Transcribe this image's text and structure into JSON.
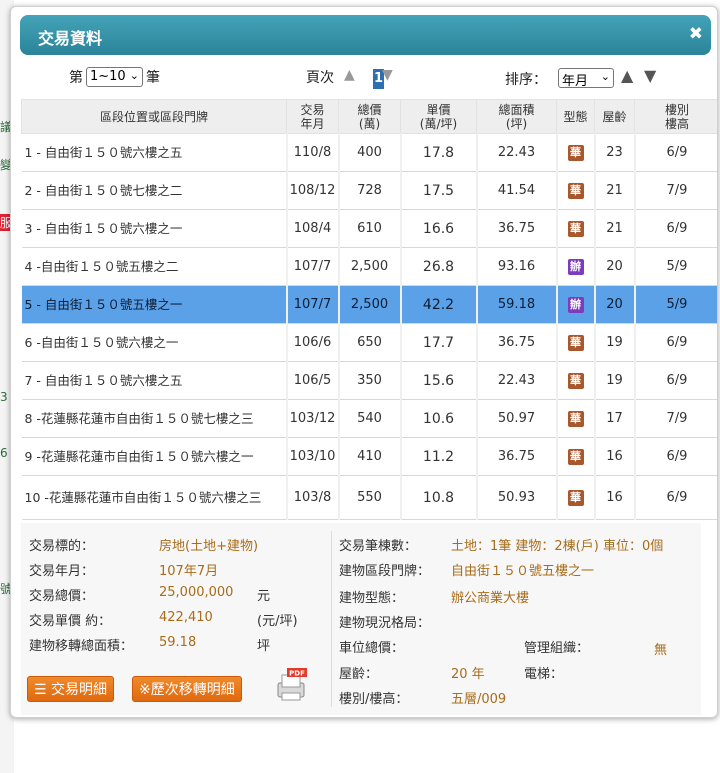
{
  "dialog": {
    "title": "交易資料",
    "close": "✖"
  },
  "controls": {
    "page_prefix": "第",
    "page_select": "1~10",
    "page_suffix": "筆",
    "page_label": "頁次",
    "page_current": "1",
    "sort_label": "排序：",
    "sort_select": "年月"
  },
  "table": {
    "headers": [
      "區段位置或區段門牌",
      "交易\n年月",
      "總價\n(萬)",
      "單價\n(萬/坪)",
      "總面積\n(坪)",
      "型態",
      "屋齡",
      "樓別\n樓高"
    ],
    "rows": [
      {
        "addr": "1 - 自由街１５０號六樓之五",
        "ym": "110/8",
        "total": "400",
        "unit": "17.8",
        "area": "22.43",
        "type": "華",
        "typeColor": "#a8582c",
        "age": "23",
        "floor": "6/9"
      },
      {
        "addr": "2 - 自由街１５０號七樓之二",
        "ym": "108/12",
        "total": "728",
        "unit": "17.5",
        "area": "41.54",
        "type": "華",
        "typeColor": "#a8582c",
        "age": "21",
        "floor": "7/9"
      },
      {
        "addr": "3 - 自由街１５０號六樓之一",
        "ym": "108/4",
        "total": "610",
        "unit": "16.6",
        "area": "36.75",
        "type": "華",
        "typeColor": "#a8582c",
        "age": "21",
        "floor": "6/9"
      },
      {
        "addr": "4 -自由街１５０號五樓之二",
        "ym": "107/7",
        "total": "2,500",
        "unit": "26.8",
        "area": "93.16",
        "type": "辦",
        "typeColor": "#7d3bbd",
        "age": "20",
        "floor": "5/9"
      },
      {
        "addr": "5 - 自由街１５０號五樓之一",
        "ym": "107/7",
        "total": "2,500",
        "unit": "42.2",
        "area": "59.18",
        "type": "辦",
        "typeColor": "#7d3bbd",
        "age": "20",
        "floor": "5/9",
        "selected": true
      },
      {
        "addr": "6 -自由街１５０號六樓之一",
        "ym": "106/6",
        "total": "650",
        "unit": "17.7",
        "area": "36.75",
        "type": "華",
        "typeColor": "#a8582c",
        "age": "19",
        "floor": "6/9"
      },
      {
        "addr": "7 - 自由街１５０號六樓之五",
        "ym": "106/5",
        "total": "350",
        "unit": "15.6",
        "area": "22.43",
        "type": "華",
        "typeColor": "#a8582c",
        "age": "19",
        "floor": "6/9"
      },
      {
        "addr": "8 -花蓮縣花蓮市自由街１５０號七樓之三",
        "ym": "103/12",
        "total": "540",
        "unit": "10.6",
        "area": "50.97",
        "type": "華",
        "typeColor": "#a8582c",
        "age": "17",
        "floor": "7/9"
      },
      {
        "addr": "9 -花蓮縣花蓮市自由街１５０號六樓之一",
        "ym": "103/10",
        "total": "410",
        "unit": "11.2",
        "area": "36.75",
        "type": "華",
        "typeColor": "#a8582c",
        "age": "16",
        "floor": "6/9"
      },
      {
        "addr": "10 -花蓮縣花蓮市自由街１５０號六樓之三",
        "ym": "103/8",
        "total": "550",
        "unit": "10.8",
        "area": "50.93",
        "type": "華",
        "typeColor": "#a8582c",
        "age": "16",
        "floor": "6/9",
        "tall": true
      }
    ]
  },
  "details": {
    "left": {
      "target_label": "交易標的：",
      "target_value": "房地(土地+建物)",
      "ym_label": "交易年月：",
      "ym_value": "107年7月",
      "total_label": "交易總價：",
      "total_value": "25,000,000",
      "total_unit": "元",
      "unit_label": "交易單價 約：",
      "unit_value": "422,410",
      "unit_unit": "(元/坪)",
      "area_label": "建物移轉總面積：",
      "area_value": "59.18",
      "area_unit": "坪"
    },
    "right": {
      "count_label": "交易筆棟數：",
      "count_value": "土地：1筆 建物：2棟(戶) 車位：0個",
      "addr_label": "建物區段門牌：",
      "addr_value": "自由街１５０號五樓之一",
      "type_label": "建物型態：",
      "type_value": "辦公商業大樓",
      "layout_label": "建物現況格局：",
      "parking_label": "車位總價：",
      "mgmt_label": "管理組織：",
      "mgmt_value": "無",
      "age_label": "屋齡：",
      "age_value": "20 年",
      "elevator_label": "電梯：",
      "floor_label": "樓別/樓高：",
      "floor_value": "五層/009"
    },
    "buttons": {
      "detail": "交易明細",
      "history": "※歷次移轉明細",
      "pdf": "PDF"
    }
  },
  "background_text": [
    "議",
    "變",
    "服",
    "3",
    "6",
    "號"
  ]
}
